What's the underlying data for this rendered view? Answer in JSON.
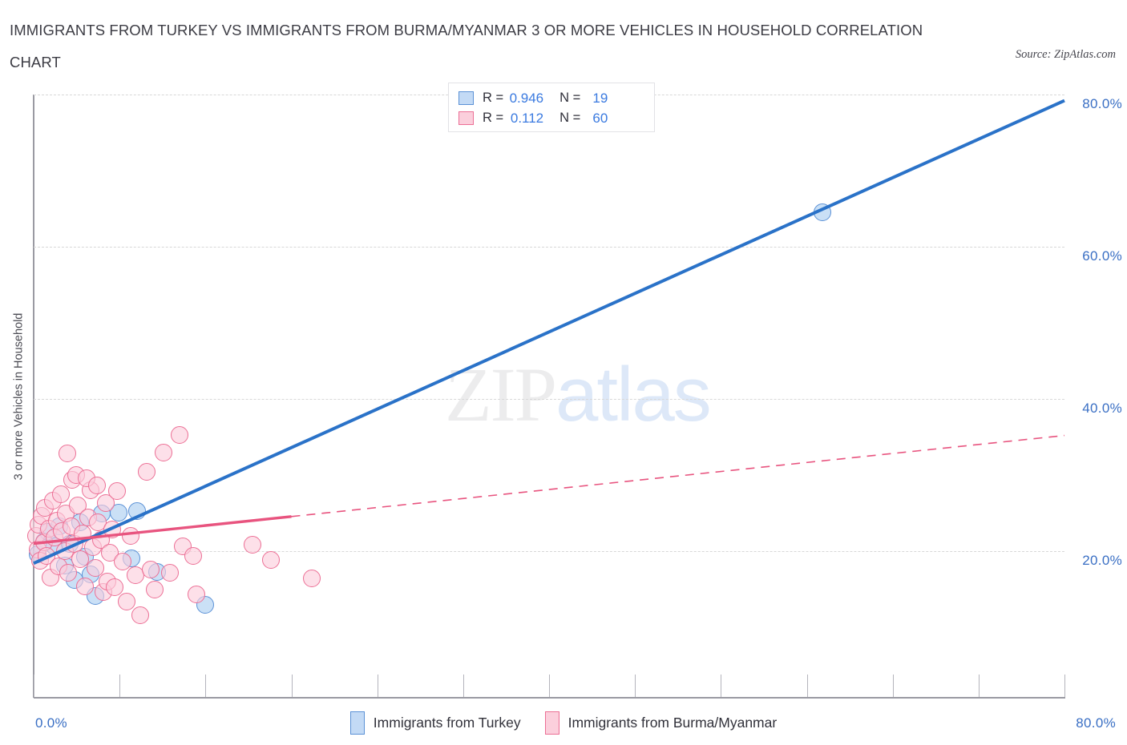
{
  "header": {
    "title_line1": "IMMIGRANTS FROM TURKEY VS IMMIGRANTS FROM BURMA/MYANMAR 3 OR MORE VEHICLES IN HOUSEHOLD CORRELATION",
    "title_line2": "CHART",
    "source": "Source: ZipAtlas.com"
  },
  "watermark": {
    "part1": "ZIP",
    "part2": "atlas"
  },
  "stats": {
    "rows": [
      {
        "series": "Immigrants from Turkey",
        "r_label": "R =",
        "r_value": "0.946",
        "n_label": "N =",
        "n_value": "19",
        "color": "#c3daf5"
      },
      {
        "series": "Immigrants from Burma/Myanmar",
        "r_label": "R =",
        "r_value": "0.112",
        "n_label": "N =",
        "n_value": "60",
        "color": "#fbcfdc"
      }
    ]
  },
  "legend": {
    "items": [
      {
        "label": "Immigrants from Turkey",
        "color": "#c3daf5"
      },
      {
        "label": "Immigrants from Burma/Myanmar",
        "color": "#fbcfdc"
      }
    ]
  },
  "axes": {
    "y_title": "3 or more Vehicles in Household",
    "y_ticks": [
      "80.0%",
      "60.0%",
      "40.0%",
      "20.0%"
    ],
    "x_min_label": "0.0%",
    "x_max_label": "80.0%"
  },
  "chart_data": {
    "type": "scatter",
    "title": "IMMIGRANTS FROM TURKEY VS IMMIGRANTS FROM BURMA/MYANMAR 3 OR MORE VEHICLES IN HOUSEHOLD CORRELATION CHART",
    "xlabel": "",
    "ylabel": "3 or more Vehicles in Household",
    "xlim": [
      0,
      80
    ],
    "ylim": [
      0,
      80
    ],
    "x_unit": "%",
    "y_unit": "%",
    "grid": true,
    "gridlines_y": [
      20,
      40,
      60,
      80
    ],
    "legend_position": "bottom-center",
    "series": [
      {
        "name": "Immigrants from Turkey",
        "color": "#aacdf0",
        "border_color": "#5b91d6",
        "r": 0.946,
        "n": 19,
        "trend": {
          "x0": 0,
          "y0": 18.4,
          "x1": 80,
          "y1": 79.2,
          "style": "solid",
          "color": "#2a72c8"
        },
        "points": [
          {
            "x": 0.3,
            "y": 19.6
          },
          {
            "x": 0.8,
            "y": 21.3
          },
          {
            "x": 1.1,
            "y": 22.5
          },
          {
            "x": 1.6,
            "y": 20.6
          },
          {
            "x": 2.0,
            "y": 23.3
          },
          {
            "x": 2.4,
            "y": 18.1
          },
          {
            "x": 2.8,
            "y": 21.0
          },
          {
            "x": 3.2,
            "y": 16.2
          },
          {
            "x": 3.6,
            "y": 23.8
          },
          {
            "x": 4.0,
            "y": 19.3
          },
          {
            "x": 4.4,
            "y": 16.9
          },
          {
            "x": 4.8,
            "y": 14.1
          },
          {
            "x": 5.3,
            "y": 25.0
          },
          {
            "x": 6.6,
            "y": 25.1
          },
          {
            "x": 7.6,
            "y": 19.1
          },
          {
            "x": 8.0,
            "y": 25.3
          },
          {
            "x": 9.6,
            "y": 17.3
          },
          {
            "x": 13.3,
            "y": 13.0
          },
          {
            "x": 61.2,
            "y": 64.5
          }
        ]
      },
      {
        "name": "Immigrants from Burma/Myanmar",
        "color": "#fccddb",
        "border_color": "#ec6f95",
        "r": 0.112,
        "n": 60,
        "trend": {
          "x0": 0,
          "y0": 21.0,
          "x1": 80,
          "y1": 35.2,
          "style": "solid-then-dashed",
          "solid_until_x": 20,
          "color": "#e8547f"
        },
        "points": [
          {
            "x": 0.2,
            "y": 22.0
          },
          {
            "x": 0.3,
            "y": 20.2
          },
          {
            "x": 0.4,
            "y": 23.5
          },
          {
            "x": 0.5,
            "y": 18.7
          },
          {
            "x": 0.6,
            "y": 24.6
          },
          {
            "x": 0.8,
            "y": 21.2
          },
          {
            "x": 0.9,
            "y": 25.7
          },
          {
            "x": 1.0,
            "y": 19.4
          },
          {
            "x": 1.2,
            "y": 23.0
          },
          {
            "x": 1.3,
            "y": 16.5
          },
          {
            "x": 1.5,
            "y": 26.6
          },
          {
            "x": 1.6,
            "y": 21.8
          },
          {
            "x": 1.8,
            "y": 24.0
          },
          {
            "x": 1.9,
            "y": 18.0
          },
          {
            "x": 2.1,
            "y": 27.5
          },
          {
            "x": 2.2,
            "y": 22.6
          },
          {
            "x": 2.4,
            "y": 20.0
          },
          {
            "x": 2.5,
            "y": 25.0
          },
          {
            "x": 2.7,
            "y": 17.2
          },
          {
            "x": 2.9,
            "y": 23.3
          },
          {
            "x": 3.0,
            "y": 29.4
          },
          {
            "x": 3.2,
            "y": 21.0
          },
          {
            "x": 3.4,
            "y": 26.0
          },
          {
            "x": 3.6,
            "y": 19.0
          },
          {
            "x": 3.8,
            "y": 22.3
          },
          {
            "x": 4.0,
            "y": 15.4
          },
          {
            "x": 4.2,
            "y": 24.4
          },
          {
            "x": 4.4,
            "y": 28.0
          },
          {
            "x": 4.6,
            "y": 20.5
          },
          {
            "x": 4.8,
            "y": 17.8
          },
          {
            "x": 5.0,
            "y": 23.8
          },
          {
            "x": 5.2,
            "y": 21.5
          },
          {
            "x": 5.4,
            "y": 14.6
          },
          {
            "x": 5.6,
            "y": 26.3
          },
          {
            "x": 5.9,
            "y": 19.8
          },
          {
            "x": 6.1,
            "y": 22.8
          },
          {
            "x": 2.6,
            "y": 32.8
          },
          {
            "x": 3.3,
            "y": 30.0
          },
          {
            "x": 4.1,
            "y": 29.6
          },
          {
            "x": 4.9,
            "y": 28.6
          },
          {
            "x": 5.7,
            "y": 16.0
          },
          {
            "x": 6.3,
            "y": 15.3
          },
          {
            "x": 6.5,
            "y": 27.9
          },
          {
            "x": 6.9,
            "y": 18.6
          },
          {
            "x": 7.2,
            "y": 13.4
          },
          {
            "x": 7.5,
            "y": 22.0
          },
          {
            "x": 7.9,
            "y": 16.8
          },
          {
            "x": 8.3,
            "y": 11.6
          },
          {
            "x": 8.8,
            "y": 30.4
          },
          {
            "x": 9.1,
            "y": 17.6
          },
          {
            "x": 9.4,
            "y": 15.0
          },
          {
            "x": 10.1,
            "y": 33.0
          },
          {
            "x": 10.6,
            "y": 17.2
          },
          {
            "x": 11.3,
            "y": 35.3
          },
          {
            "x": 11.6,
            "y": 20.6
          },
          {
            "x": 12.4,
            "y": 19.4
          },
          {
            "x": 12.6,
            "y": 14.3
          },
          {
            "x": 17.0,
            "y": 20.8
          },
          {
            "x": 18.4,
            "y": 18.8
          },
          {
            "x": 21.6,
            "y": 16.4
          }
        ]
      }
    ]
  }
}
